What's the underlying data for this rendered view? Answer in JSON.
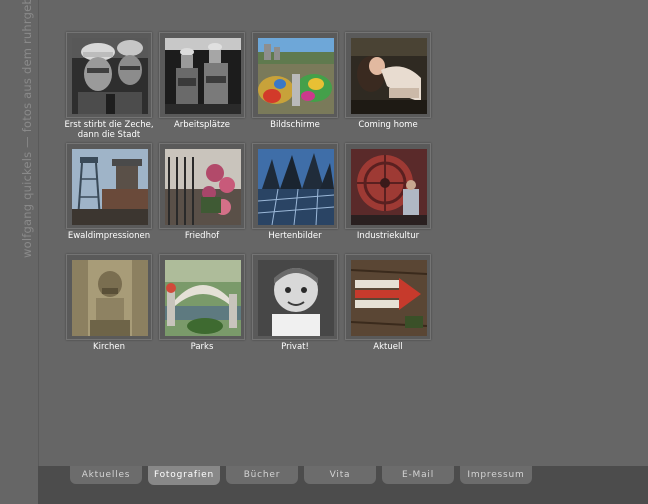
{
  "site": {
    "title": "wolfgang quickels — fotos aus dem ruhrgebiet"
  },
  "gallery": {
    "items": [
      {
        "caption": "Erst stirbt die Zeche,\ndann die Stadt",
        "icon": "miners-photo"
      },
      {
        "caption": "Arbeitsplätze",
        "icon": "workers-photo"
      },
      {
        "caption": "Bildschirme",
        "icon": "art-landscape-photo"
      },
      {
        "caption": "Coming home",
        "icon": "woman-photo"
      },
      {
        "caption": "Ewaldimpressionen",
        "icon": "headframe-photo"
      },
      {
        "caption": "Friedhof",
        "icon": "cemetery-flowers-photo"
      },
      {
        "caption": "Hertenbilder",
        "icon": "glass-structure-photo"
      },
      {
        "caption": "Industriekultur",
        "icon": "wheel-machine-photo"
      },
      {
        "caption": "Kirchen",
        "icon": "stone-sculpture-photo"
      },
      {
        "caption": "Parks",
        "icon": "park-bridge-photo"
      },
      {
        "caption": "Privat!",
        "icon": "child-portrait-photo"
      },
      {
        "caption": "Aktuell",
        "icon": "arrow-tree-photo"
      }
    ]
  },
  "nav": {
    "active": "Fotografien",
    "tabs": [
      "Aktuelles",
      "Fotografien",
      "Bücher",
      "Vita",
      "E-Mail",
      "Impressum"
    ]
  },
  "colors": {
    "background": "#666666",
    "bottom_bar": "#4c4c4c",
    "tab": "#6c6c6c",
    "tab_active": "#888888"
  }
}
